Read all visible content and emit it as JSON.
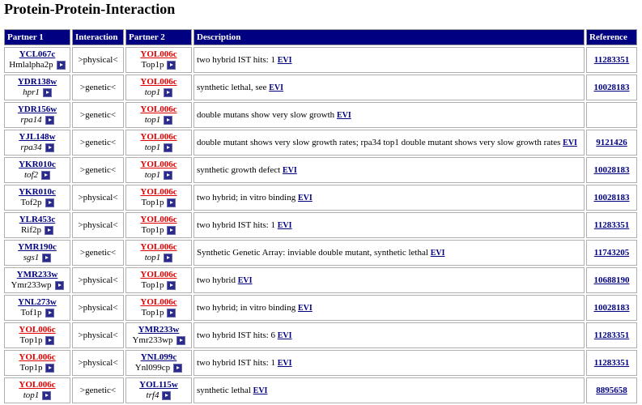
{
  "title": "Protein-Protein-Interaction",
  "headers": [
    "Partner 1",
    "Interaction",
    "Partner 2",
    "Description",
    "Reference"
  ],
  "evi_label": "EVI",
  "rows": [
    {
      "p1_id": "YCL067c",
      "p1_name": "Hmlalpha2p",
      "p1_it": false,
      "p1_self": false,
      "interaction": ">physical<",
      "p2_id": "YOL006c",
      "p2_name": "Top1p",
      "p2_it": false,
      "p2_self": true,
      "desc": "two hybrid IST hits: 1",
      "ref": "11283351"
    },
    {
      "p1_id": "YDR138w",
      "p1_name": "hpr1",
      "p1_it": true,
      "p1_self": false,
      "interaction": ">genetic<",
      "p2_id": "YOL006c",
      "p2_name": "top1",
      "p2_it": true,
      "p2_self": true,
      "desc": "synthetic lethal, see",
      "ref": "10028183"
    },
    {
      "p1_id": "YDR156w",
      "p1_name": "rpa14",
      "p1_it": true,
      "p1_self": false,
      "interaction": ">genetic<",
      "p2_id": "YOL006c",
      "p2_name": "top1",
      "p2_it": true,
      "p2_self": true,
      "desc": "double mutans show very slow growth",
      "ref": ""
    },
    {
      "p1_id": "YJL148w",
      "p1_name": "rpa34",
      "p1_it": true,
      "p1_self": false,
      "interaction": ">genetic<",
      "p2_id": "YOL006c",
      "p2_name": "top1",
      "p2_it": true,
      "p2_self": true,
      "desc": "double mutant shows very slow growth rates; rpa34 top1 double mutant shows very slow growth rates",
      "ref": "9121426"
    },
    {
      "p1_id": "YKR010c",
      "p1_name": "tof2",
      "p1_it": true,
      "p1_self": false,
      "interaction": ">genetic<",
      "p2_id": "YOL006c",
      "p2_name": "top1",
      "p2_it": true,
      "p2_self": true,
      "desc": "synthetic growth defect",
      "ref": "10028183"
    },
    {
      "p1_id": "YKR010c",
      "p1_name": "Tof2p",
      "p1_it": false,
      "p1_self": false,
      "interaction": ">physical<",
      "p2_id": "YOL006c",
      "p2_name": "Top1p",
      "p2_it": false,
      "p2_self": true,
      "desc": "two hybrid; in vitro binding",
      "ref": "10028183"
    },
    {
      "p1_id": "YLR453c",
      "p1_name": "Rif2p",
      "p1_it": false,
      "p1_self": false,
      "interaction": ">physical<",
      "p2_id": "YOL006c",
      "p2_name": "Top1p",
      "p2_it": false,
      "p2_self": true,
      "desc": "two hybrid IST hits: 1",
      "ref": "11283351"
    },
    {
      "p1_id": "YMR190c",
      "p1_name": "sgs1",
      "p1_it": true,
      "p1_self": false,
      "interaction": ">genetic<",
      "p2_id": "YOL006c",
      "p2_name": "top1",
      "p2_it": true,
      "p2_self": true,
      "desc": "Synthetic Genetic Array: inviable double mutant, synthetic lethal",
      "ref": "11743205"
    },
    {
      "p1_id": "YMR233w",
      "p1_name": "Ymr233wp",
      "p1_it": false,
      "p1_self": false,
      "interaction": ">physical<",
      "p2_id": "YOL006c",
      "p2_name": "Top1p",
      "p2_it": false,
      "p2_self": true,
      "desc": "two hybrid",
      "ref": "10688190"
    },
    {
      "p1_id": "YNL273w",
      "p1_name": "Tof1p",
      "p1_it": false,
      "p1_self": false,
      "interaction": ">physical<",
      "p2_id": "YOL006c",
      "p2_name": "Top1p",
      "p2_it": false,
      "p2_self": true,
      "desc": "two hybrid; in vitro binding",
      "ref": "10028183"
    },
    {
      "p1_id": "YOL006c",
      "p1_name": "Top1p",
      "p1_it": false,
      "p1_self": true,
      "interaction": ">physical<",
      "p2_id": "YMR233w",
      "p2_name": "Ymr233wp",
      "p2_it": false,
      "p2_self": false,
      "desc": "two hybrid IST hits: 6",
      "ref": "11283351"
    },
    {
      "p1_id": "YOL006c",
      "p1_name": "Top1p",
      "p1_it": false,
      "p1_self": true,
      "interaction": ">physical<",
      "p2_id": "YNL099c",
      "p2_name": "Ynl099cp",
      "p2_it": false,
      "p2_self": false,
      "desc": "two hybrid IST hits: 1",
      "ref": "11283351"
    },
    {
      "p1_id": "YOL006c",
      "p1_name": "top1",
      "p1_it": true,
      "p1_self": true,
      "interaction": ">genetic<",
      "p2_id": "YOL115w",
      "p2_name": "trf4",
      "p2_it": true,
      "p2_self": false,
      "desc": "synthetic lethal",
      "ref": "8895658"
    }
  ]
}
